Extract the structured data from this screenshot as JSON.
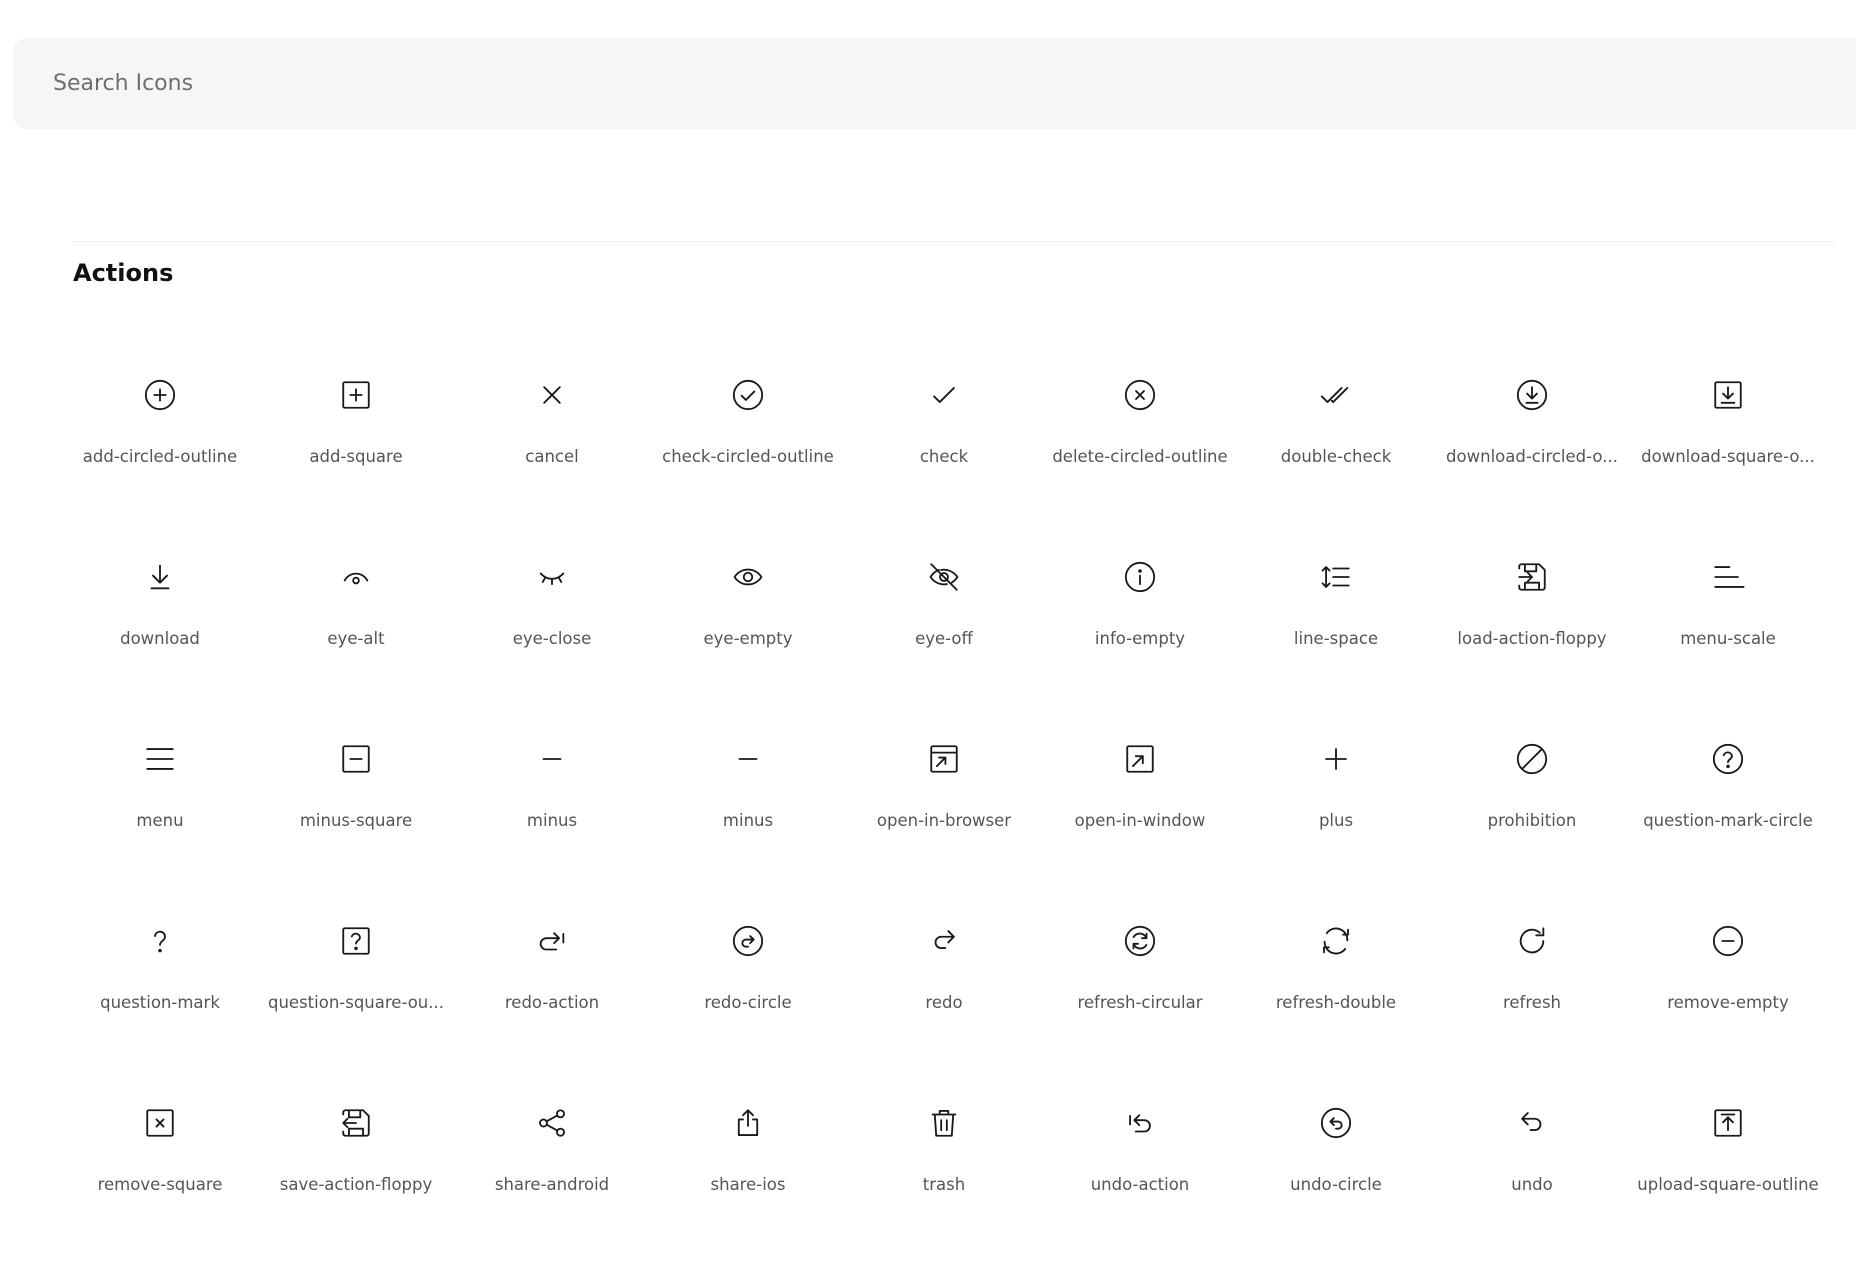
{
  "search": {
    "placeholder": "Search Icons",
    "value": ""
  },
  "section": {
    "title": "Actions"
  },
  "icons": [
    {
      "label": "add-circled-outline",
      "icon": "add-circled-outline"
    },
    {
      "label": "add-square",
      "icon": "add-square"
    },
    {
      "label": "cancel",
      "icon": "cancel"
    },
    {
      "label": "check-circled-outline",
      "icon": "check-circled-outline"
    },
    {
      "label": "check",
      "icon": "check"
    },
    {
      "label": "delete-circled-outline",
      "icon": "delete-circled-outline"
    },
    {
      "label": "double-check",
      "icon": "double-check"
    },
    {
      "label": "download-circled-o...",
      "icon": "download-circled-outline"
    },
    {
      "label": "download-square-o...",
      "icon": "download-square-outline"
    },
    {
      "label": "download",
      "icon": "download"
    },
    {
      "label": "eye-alt",
      "icon": "eye-alt"
    },
    {
      "label": "eye-close",
      "icon": "eye-close"
    },
    {
      "label": "eye-empty",
      "icon": "eye-empty"
    },
    {
      "label": "eye-off",
      "icon": "eye-off"
    },
    {
      "label": "info-empty",
      "icon": "info-empty"
    },
    {
      "label": "line-space",
      "icon": "line-space"
    },
    {
      "label": "load-action-floppy",
      "icon": "load-action-floppy"
    },
    {
      "label": "menu-scale",
      "icon": "menu-scale"
    },
    {
      "label": "menu",
      "icon": "menu"
    },
    {
      "label": "minus-square",
      "icon": "minus-square"
    },
    {
      "label": "minus",
      "icon": "minus"
    },
    {
      "label": "minus",
      "icon": "minus"
    },
    {
      "label": "open-in-browser",
      "icon": "open-in-browser"
    },
    {
      "label": "open-in-window",
      "icon": "open-in-window"
    },
    {
      "label": "plus",
      "icon": "plus"
    },
    {
      "label": "prohibition",
      "icon": "prohibition"
    },
    {
      "label": "question-mark-circle",
      "icon": "question-mark-circle"
    },
    {
      "label": "question-mark",
      "icon": "question-mark"
    },
    {
      "label": "question-square-ou...",
      "icon": "question-square-outline"
    },
    {
      "label": "redo-action",
      "icon": "redo-action"
    },
    {
      "label": "redo-circle",
      "icon": "redo-circle"
    },
    {
      "label": "redo",
      "icon": "redo"
    },
    {
      "label": "refresh-circular",
      "icon": "refresh-circular"
    },
    {
      "label": "refresh-double",
      "icon": "refresh-double"
    },
    {
      "label": "refresh",
      "icon": "refresh"
    },
    {
      "label": "remove-empty",
      "icon": "remove-empty"
    },
    {
      "label": "remove-square",
      "icon": "remove-square"
    },
    {
      "label": "save-action-floppy",
      "icon": "save-action-floppy"
    },
    {
      "label": "share-android",
      "icon": "share-android"
    },
    {
      "label": "share-ios",
      "icon": "share-ios"
    },
    {
      "label": "trash",
      "icon": "trash"
    },
    {
      "label": "undo-action",
      "icon": "undo-action"
    },
    {
      "label": "undo-circle",
      "icon": "undo-circle"
    },
    {
      "label": "undo",
      "icon": "undo"
    },
    {
      "label": "upload-square-outline",
      "icon": "upload-square-outline"
    }
  ]
}
